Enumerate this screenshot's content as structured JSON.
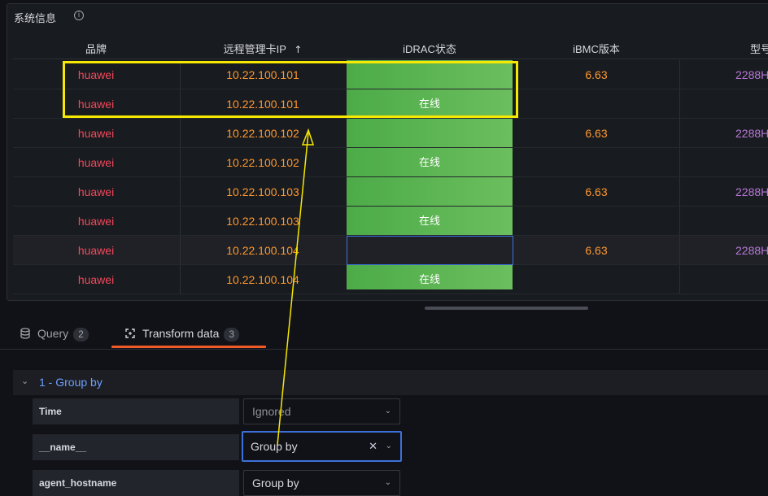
{
  "panel": {
    "title": "系统信息",
    "info_icon": "info-icon"
  },
  "table": {
    "headers": {
      "brand": "品牌",
      "ip": "远程管理卡IP",
      "ip_sort": "↑",
      "status": "iDRAC状态",
      "version": "iBMC版本",
      "model": "型号"
    },
    "rows": [
      {
        "brand": "huawei",
        "ip": "10.22.100.101",
        "status": "",
        "version": "6.63",
        "model": "2288H"
      },
      {
        "brand": "huawei",
        "ip": "10.22.100.101",
        "status": "在线",
        "version": "",
        "model": ""
      },
      {
        "brand": "huawei",
        "ip": "10.22.100.102",
        "status": "",
        "version": "6.63",
        "model": "2288H"
      },
      {
        "brand": "huawei",
        "ip": "10.22.100.102",
        "status": "在线",
        "version": "",
        "model": ""
      },
      {
        "brand": "huawei",
        "ip": "10.22.100.103",
        "status": "",
        "version": "6.63",
        "model": "2288H"
      },
      {
        "brand": "huawei",
        "ip": "10.22.100.103",
        "status": "在线",
        "version": "",
        "model": ""
      },
      {
        "brand": "huawei",
        "ip": "10.22.100.104",
        "status": "",
        "version": "6.63",
        "model": "2288H"
      },
      {
        "brand": "huawei",
        "ip": "10.22.100.104",
        "status": "在线",
        "version": "",
        "model": ""
      }
    ]
  },
  "tabs": [
    {
      "label": "Query",
      "count": "2",
      "icon": "database-icon"
    },
    {
      "label": "Transform data",
      "count": "3",
      "icon": "transform-icon"
    }
  ],
  "transform": {
    "title": "1 - Group by",
    "fields": [
      {
        "name": "Time",
        "value": "Ignored"
      },
      {
        "name": "__name__",
        "value": "Group by"
      },
      {
        "name": "agent_hostname",
        "value": "Group by"
      }
    ]
  },
  "colors": {
    "brand": "#f2495c",
    "ip": "#ff9830",
    "model": "#b877d9",
    "status_green": "#56b24f",
    "accent": "#f05a28",
    "annotation": "#f6e800"
  }
}
